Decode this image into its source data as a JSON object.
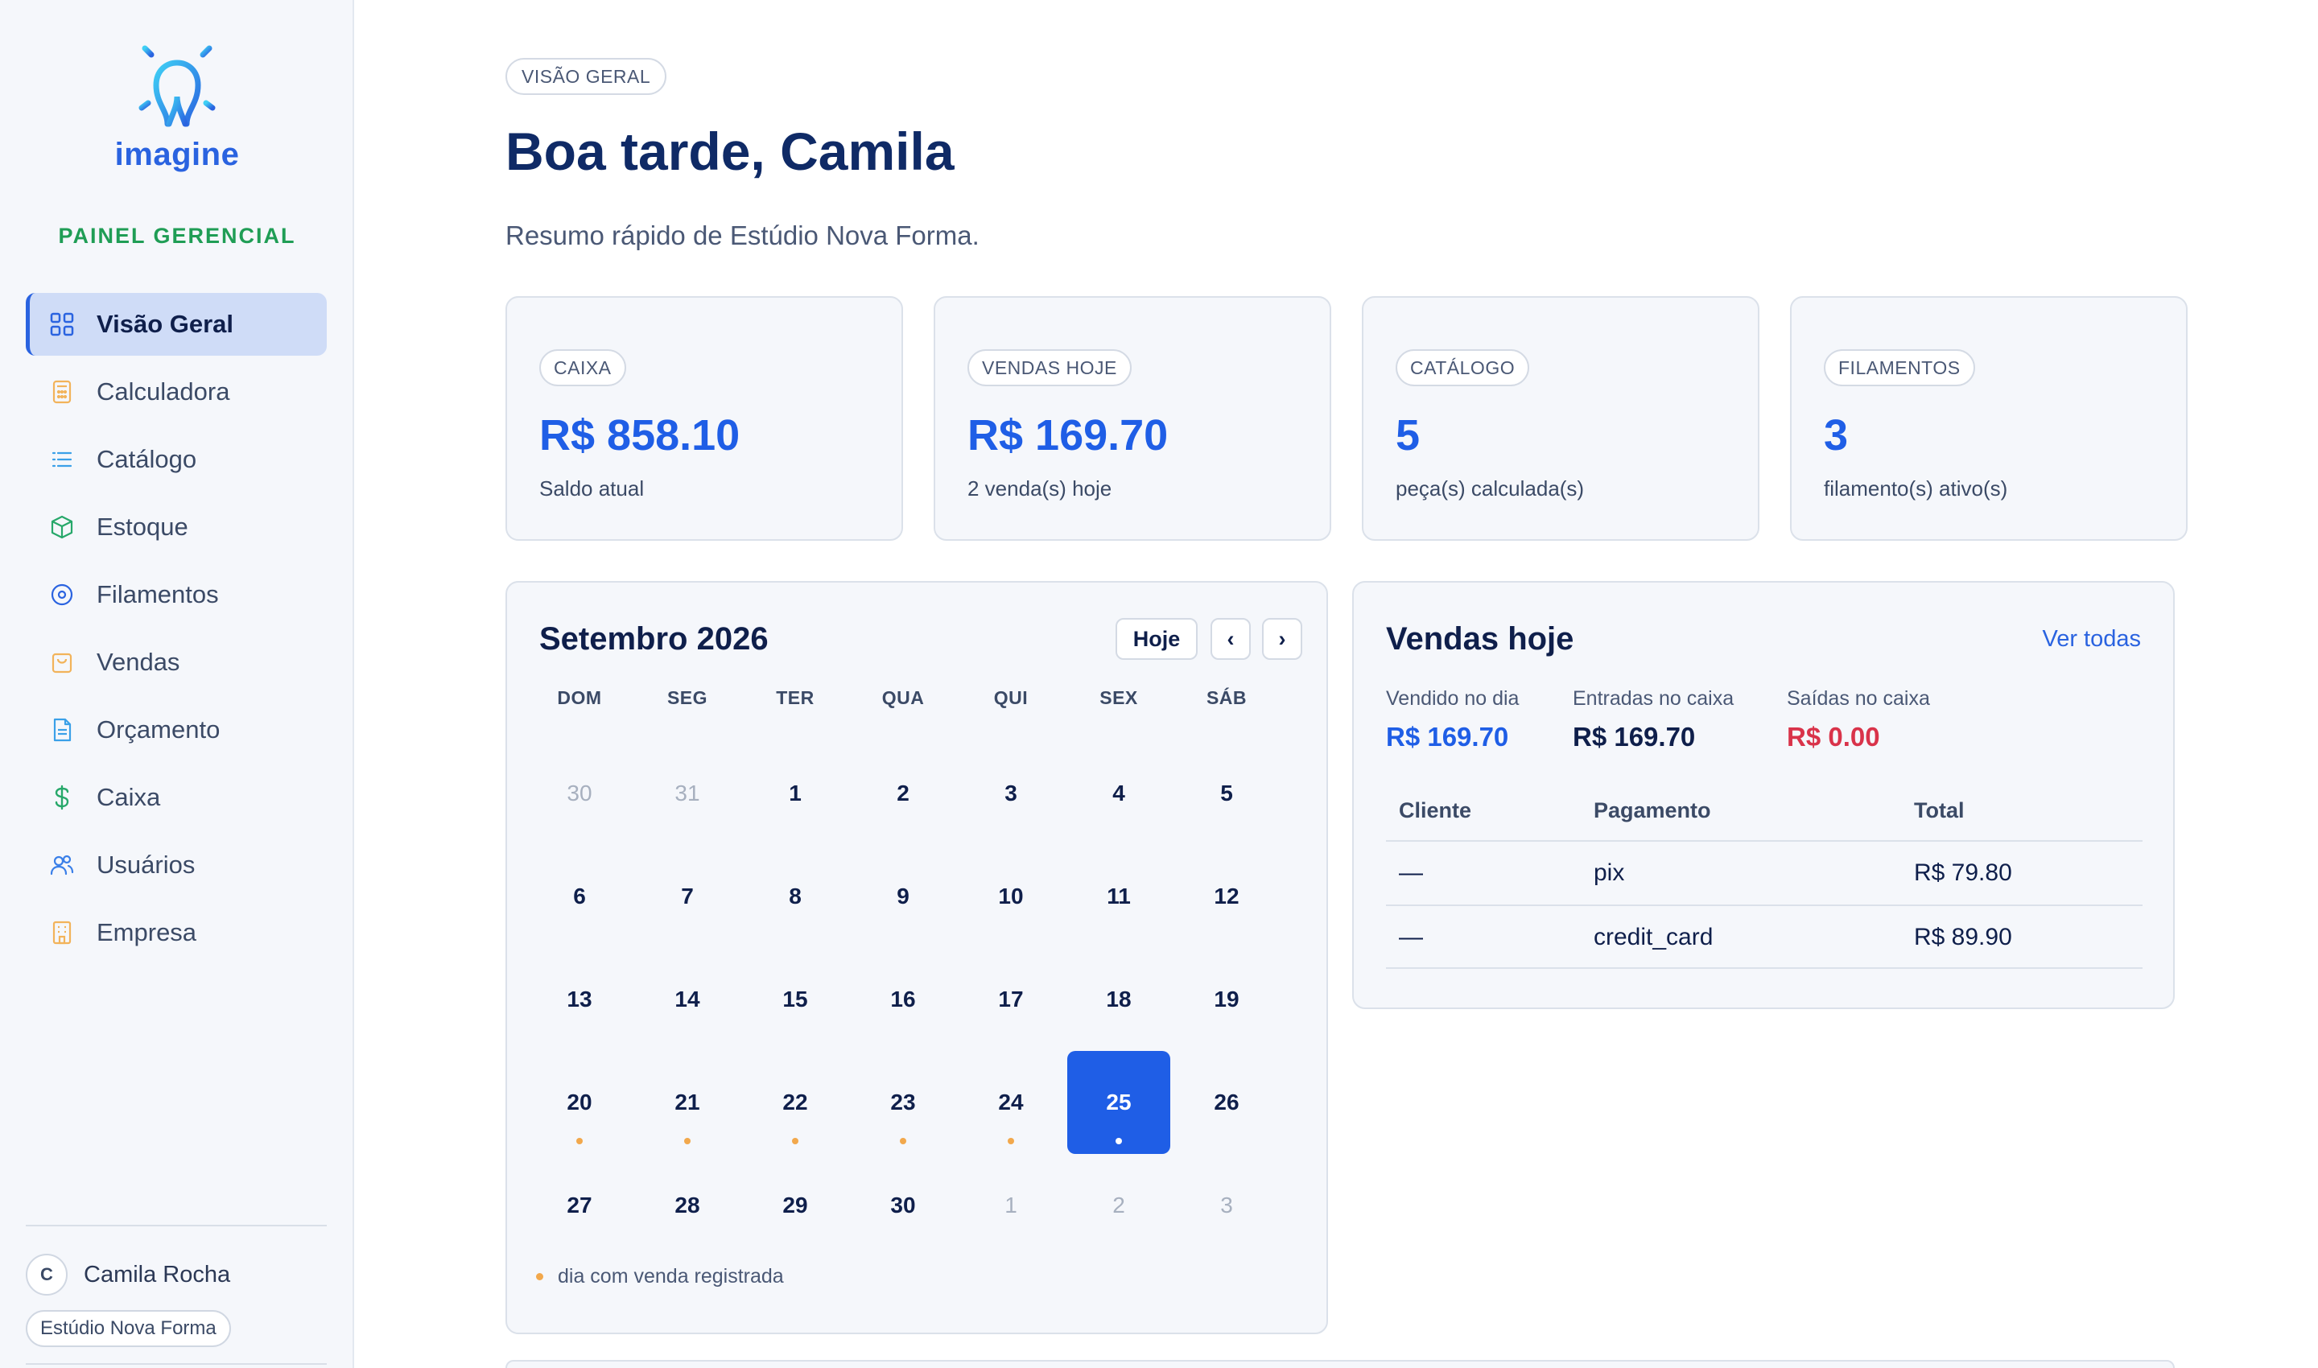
{
  "brand": {
    "name": "imagine",
    "panel_label": "PAINEL GERENCIAL"
  },
  "colors": {
    "accent": "#1f5ee6",
    "brand_green": "#1f9d55",
    "negative": "#d9334a",
    "event_dot": "#f2a84c"
  },
  "sidebar": {
    "items": [
      {
        "label": "Visão Geral",
        "icon": "grid-icon",
        "active": true
      },
      {
        "label": "Calculadora",
        "icon": "calculator-icon"
      },
      {
        "label": "Catálogo",
        "icon": "list-icon"
      },
      {
        "label": "Estoque",
        "icon": "box-icon"
      },
      {
        "label": "Filamentos",
        "icon": "spool-icon"
      },
      {
        "label": "Vendas",
        "icon": "shopping-bag-icon"
      },
      {
        "label": "Orçamento",
        "icon": "document-icon"
      },
      {
        "label": "Caixa",
        "icon": "dollar-icon"
      },
      {
        "label": "Usuários",
        "icon": "users-icon"
      },
      {
        "label": "Empresa",
        "icon": "building-icon"
      }
    ],
    "user": {
      "initial": "C",
      "name": "Camila Rocha",
      "company": "Estúdio Nova Forma"
    }
  },
  "header": {
    "breadcrumb": "VISÃO GERAL",
    "title": "Boa tarde, Camila",
    "subtitle": "Resumo rápido de Estúdio Nova Forma."
  },
  "stats": [
    {
      "chip": "CAIXA",
      "value": "R$ 858.10",
      "desc": "Saldo atual"
    },
    {
      "chip": "VENDAS HOJE",
      "value": "R$ 169.70",
      "desc": "2 venda(s) hoje"
    },
    {
      "chip": "CATÁLOGO",
      "value": "5",
      "desc": "peça(s) calculada(s)"
    },
    {
      "chip": "FILAMENTOS",
      "value": "3",
      "desc": "filamento(s) ativo(s)"
    }
  ],
  "calendar": {
    "month_label": "Setembro 2026",
    "today_button": "Hoje",
    "prev_button": "‹",
    "next_button": "›",
    "weekdays": [
      "DOM",
      "SEG",
      "TER",
      "QUA",
      "QUI",
      "SEX",
      "SÁB"
    ],
    "weeks": [
      [
        {
          "d": "30",
          "m": true
        },
        {
          "d": "31",
          "m": true
        },
        {
          "d": "1"
        },
        {
          "d": "2"
        },
        {
          "d": "3"
        },
        {
          "d": "4"
        },
        {
          "d": "5"
        }
      ],
      [
        {
          "d": "6"
        },
        {
          "d": "7"
        },
        {
          "d": "8"
        },
        {
          "d": "9"
        },
        {
          "d": "10"
        },
        {
          "d": "11"
        },
        {
          "d": "12"
        }
      ],
      [
        {
          "d": "13"
        },
        {
          "d": "14"
        },
        {
          "d": "15"
        },
        {
          "d": "16"
        },
        {
          "d": "17"
        },
        {
          "d": "18"
        },
        {
          "d": "19"
        }
      ],
      [
        {
          "d": "20",
          "dot": true
        },
        {
          "d": "21",
          "dot": true
        },
        {
          "d": "22",
          "dot": true
        },
        {
          "d": "23",
          "dot": true
        },
        {
          "d": "24",
          "dot": true
        },
        {
          "d": "25",
          "dot": true,
          "today": true
        },
        {
          "d": "26"
        }
      ],
      [
        {
          "d": "27"
        },
        {
          "d": "28"
        },
        {
          "d": "29"
        },
        {
          "d": "30"
        },
        {
          "d": "1",
          "m": true
        },
        {
          "d": "2",
          "m": true
        },
        {
          "d": "3",
          "m": true
        }
      ]
    ],
    "legend": "dia com venda registrada"
  },
  "sales_today": {
    "title": "Vendas hoje",
    "see_all": "Ver todas",
    "kpis": [
      {
        "label": "Vendido no dia",
        "value": "R$ 169.70",
        "color": "#1f5ee6"
      },
      {
        "label": "Entradas no caixa",
        "value": "R$ 169.70",
        "color": "#0f1f4b"
      },
      {
        "label": "Saídas no caixa",
        "value": "R$ 0.00",
        "color": "#d9334a"
      }
    ],
    "columns": [
      "Cliente",
      "Pagamento",
      "Total"
    ],
    "rows": [
      [
        "—",
        "pix",
        "R$ 79.80"
      ],
      [
        "—",
        "credit_card",
        "R$ 89.90"
      ]
    ]
  }
}
